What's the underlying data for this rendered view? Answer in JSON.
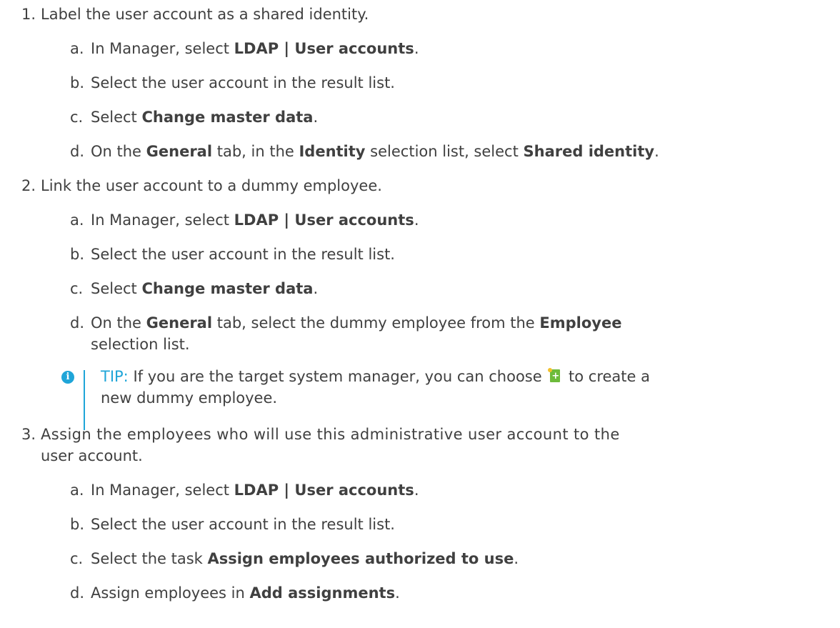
{
  "steps": [
    {
      "num": "1.",
      "text": "Label the user account as a shared identity.",
      "subs": [
        {
          "letter": "a.",
          "parts": [
            {
              "t": "In Manager, select "
            },
            {
              "b": "LDAP | User accounts"
            },
            {
              "t": "."
            }
          ]
        },
        {
          "letter": "b.",
          "parts": [
            {
              "t": "Select the user account in the result list."
            }
          ]
        },
        {
          "letter": "c.",
          "parts": [
            {
              "t": "Select "
            },
            {
              "b": "Change master data"
            },
            {
              "t": "."
            }
          ]
        },
        {
          "letter": "d.",
          "parts": [
            {
              "t": "On the "
            },
            {
              "b": "General"
            },
            {
              "t": " tab, in the "
            },
            {
              "b": "Identity"
            },
            {
              "t": " selection list, select "
            },
            {
              "b": "Shared identity"
            },
            {
              "t": "."
            }
          ]
        }
      ]
    },
    {
      "num": "2.",
      "text": "Link the user account to a dummy employee.",
      "subs": [
        {
          "letter": "a.",
          "parts": [
            {
              "t": "In Manager, select "
            },
            {
              "b": "LDAP | User accounts"
            },
            {
              "t": "."
            }
          ]
        },
        {
          "letter": "b.",
          "parts": [
            {
              "t": "Select the user account in the result list."
            }
          ]
        },
        {
          "letter": "c.",
          "parts": [
            {
              "t": "Select "
            },
            {
              "b": "Change master data"
            },
            {
              "t": "."
            }
          ]
        },
        {
          "letter": "d.",
          "parts": [
            {
              "t": "On the "
            },
            {
              "b": "General"
            },
            {
              "t": " tab, select the dummy employee from the "
            },
            {
              "b": "Employee"
            }
          ],
          "line2": "selection list."
        }
      ],
      "tip": {
        "label": "TIP:",
        "text_before_icon": " If you are the target system manager, you can choose ",
        "text_after_icon": " to create a",
        "line2": "new dummy employee.",
        "icon": "new-document-icon"
      }
    },
    {
      "num": "3.",
      "text": "Assign the employees who will use this administrative user account to the",
      "text_line2": "user account.",
      "subs": [
        {
          "letter": "a.",
          "parts": [
            {
              "t": "In Manager, select "
            },
            {
              "b": "LDAP | User accounts"
            },
            {
              "t": "."
            }
          ]
        },
        {
          "letter": "b.",
          "parts": [
            {
              "t": "Select the user account in the result list."
            }
          ]
        },
        {
          "letter": "c.",
          "parts": [
            {
              "t": "Select the task "
            },
            {
              "b": "Assign employees authorized to use"
            },
            {
              "t": "."
            }
          ]
        },
        {
          "letter": "d.",
          "parts": [
            {
              "t": "Assign employees in "
            },
            {
              "b": "Add assignments"
            },
            {
              "t": "."
            }
          ]
        }
      ]
    }
  ],
  "colors": {
    "text": "#404040",
    "tip_accent": "#1fa5d8",
    "icon_green": "#6dbb3b"
  }
}
